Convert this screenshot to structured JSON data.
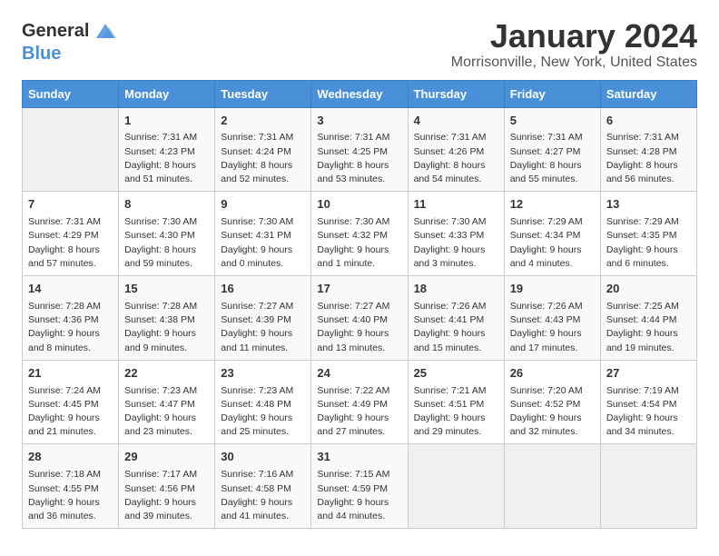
{
  "header": {
    "logo_general": "General",
    "logo_blue": "Blue",
    "month": "January 2024",
    "location": "Morrisonville, New York, United States"
  },
  "days_of_week": [
    "Sunday",
    "Monday",
    "Tuesday",
    "Wednesday",
    "Thursday",
    "Friday",
    "Saturday"
  ],
  "weeks": [
    [
      {
        "day": "",
        "sunrise": "",
        "sunset": "",
        "daylight": ""
      },
      {
        "day": "1",
        "sunrise": "Sunrise: 7:31 AM",
        "sunset": "Sunset: 4:23 PM",
        "daylight": "Daylight: 8 hours and 51 minutes."
      },
      {
        "day": "2",
        "sunrise": "Sunrise: 7:31 AM",
        "sunset": "Sunset: 4:24 PM",
        "daylight": "Daylight: 8 hours and 52 minutes."
      },
      {
        "day": "3",
        "sunrise": "Sunrise: 7:31 AM",
        "sunset": "Sunset: 4:25 PM",
        "daylight": "Daylight: 8 hours and 53 minutes."
      },
      {
        "day": "4",
        "sunrise": "Sunrise: 7:31 AM",
        "sunset": "Sunset: 4:26 PM",
        "daylight": "Daylight: 8 hours and 54 minutes."
      },
      {
        "day": "5",
        "sunrise": "Sunrise: 7:31 AM",
        "sunset": "Sunset: 4:27 PM",
        "daylight": "Daylight: 8 hours and 55 minutes."
      },
      {
        "day": "6",
        "sunrise": "Sunrise: 7:31 AM",
        "sunset": "Sunset: 4:28 PM",
        "daylight": "Daylight: 8 hours and 56 minutes."
      }
    ],
    [
      {
        "day": "7",
        "sunrise": "Sunrise: 7:31 AM",
        "sunset": "Sunset: 4:29 PM",
        "daylight": "Daylight: 8 hours and 57 minutes."
      },
      {
        "day": "8",
        "sunrise": "Sunrise: 7:30 AM",
        "sunset": "Sunset: 4:30 PM",
        "daylight": "Daylight: 8 hours and 59 minutes."
      },
      {
        "day": "9",
        "sunrise": "Sunrise: 7:30 AM",
        "sunset": "Sunset: 4:31 PM",
        "daylight": "Daylight: 9 hours and 0 minutes."
      },
      {
        "day": "10",
        "sunrise": "Sunrise: 7:30 AM",
        "sunset": "Sunset: 4:32 PM",
        "daylight": "Daylight: 9 hours and 1 minute."
      },
      {
        "day": "11",
        "sunrise": "Sunrise: 7:30 AM",
        "sunset": "Sunset: 4:33 PM",
        "daylight": "Daylight: 9 hours and 3 minutes."
      },
      {
        "day": "12",
        "sunrise": "Sunrise: 7:29 AM",
        "sunset": "Sunset: 4:34 PM",
        "daylight": "Daylight: 9 hours and 4 minutes."
      },
      {
        "day": "13",
        "sunrise": "Sunrise: 7:29 AM",
        "sunset": "Sunset: 4:35 PM",
        "daylight": "Daylight: 9 hours and 6 minutes."
      }
    ],
    [
      {
        "day": "14",
        "sunrise": "Sunrise: 7:28 AM",
        "sunset": "Sunset: 4:36 PM",
        "daylight": "Daylight: 9 hours and 8 minutes."
      },
      {
        "day": "15",
        "sunrise": "Sunrise: 7:28 AM",
        "sunset": "Sunset: 4:38 PM",
        "daylight": "Daylight: 9 hours and 9 minutes."
      },
      {
        "day": "16",
        "sunrise": "Sunrise: 7:27 AM",
        "sunset": "Sunset: 4:39 PM",
        "daylight": "Daylight: 9 hours and 11 minutes."
      },
      {
        "day": "17",
        "sunrise": "Sunrise: 7:27 AM",
        "sunset": "Sunset: 4:40 PM",
        "daylight": "Daylight: 9 hours and 13 minutes."
      },
      {
        "day": "18",
        "sunrise": "Sunrise: 7:26 AM",
        "sunset": "Sunset: 4:41 PM",
        "daylight": "Daylight: 9 hours and 15 minutes."
      },
      {
        "day": "19",
        "sunrise": "Sunrise: 7:26 AM",
        "sunset": "Sunset: 4:43 PM",
        "daylight": "Daylight: 9 hours and 17 minutes."
      },
      {
        "day": "20",
        "sunrise": "Sunrise: 7:25 AM",
        "sunset": "Sunset: 4:44 PM",
        "daylight": "Daylight: 9 hours and 19 minutes."
      }
    ],
    [
      {
        "day": "21",
        "sunrise": "Sunrise: 7:24 AM",
        "sunset": "Sunset: 4:45 PM",
        "daylight": "Daylight: 9 hours and 21 minutes."
      },
      {
        "day": "22",
        "sunrise": "Sunrise: 7:23 AM",
        "sunset": "Sunset: 4:47 PM",
        "daylight": "Daylight: 9 hours and 23 minutes."
      },
      {
        "day": "23",
        "sunrise": "Sunrise: 7:23 AM",
        "sunset": "Sunset: 4:48 PM",
        "daylight": "Daylight: 9 hours and 25 minutes."
      },
      {
        "day": "24",
        "sunrise": "Sunrise: 7:22 AM",
        "sunset": "Sunset: 4:49 PM",
        "daylight": "Daylight: 9 hours and 27 minutes."
      },
      {
        "day": "25",
        "sunrise": "Sunrise: 7:21 AM",
        "sunset": "Sunset: 4:51 PM",
        "daylight": "Daylight: 9 hours and 29 minutes."
      },
      {
        "day": "26",
        "sunrise": "Sunrise: 7:20 AM",
        "sunset": "Sunset: 4:52 PM",
        "daylight": "Daylight: 9 hours and 32 minutes."
      },
      {
        "day": "27",
        "sunrise": "Sunrise: 7:19 AM",
        "sunset": "Sunset: 4:54 PM",
        "daylight": "Daylight: 9 hours and 34 minutes."
      }
    ],
    [
      {
        "day": "28",
        "sunrise": "Sunrise: 7:18 AM",
        "sunset": "Sunset: 4:55 PM",
        "daylight": "Daylight: 9 hours and 36 minutes."
      },
      {
        "day": "29",
        "sunrise": "Sunrise: 7:17 AM",
        "sunset": "Sunset: 4:56 PM",
        "daylight": "Daylight: 9 hours and 39 minutes."
      },
      {
        "day": "30",
        "sunrise": "Sunrise: 7:16 AM",
        "sunset": "Sunset: 4:58 PM",
        "daylight": "Daylight: 9 hours and 41 minutes."
      },
      {
        "day": "31",
        "sunrise": "Sunrise: 7:15 AM",
        "sunset": "Sunset: 4:59 PM",
        "daylight": "Daylight: 9 hours and 44 minutes."
      },
      {
        "day": "",
        "sunrise": "",
        "sunset": "",
        "daylight": ""
      },
      {
        "day": "",
        "sunrise": "",
        "sunset": "",
        "daylight": ""
      },
      {
        "day": "",
        "sunrise": "",
        "sunset": "",
        "daylight": ""
      }
    ]
  ]
}
